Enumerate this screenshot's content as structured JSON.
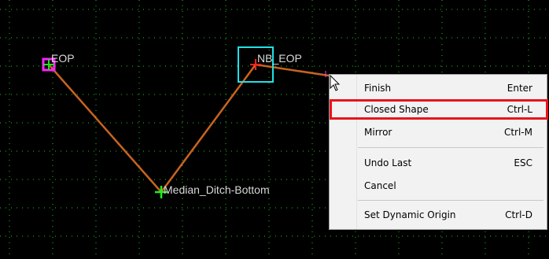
{
  "canvas": {
    "background": "#000000",
    "grid_color": "#1ec81e",
    "line_color": "#c8641e"
  },
  "points": {
    "eop": "EOP",
    "nb_eop": "NB_EOP",
    "median": "Median_Ditch-Bottom"
  },
  "context_menu": {
    "items": [
      {
        "label": "Finish",
        "shortcut": "Enter"
      },
      {
        "label": "Closed Shape",
        "shortcut": "Ctrl-L"
      },
      {
        "label": "Mirror",
        "shortcut": "Ctrl-M"
      },
      {
        "label": "Undo Last",
        "shortcut": "ESC"
      },
      {
        "label": "Cancel",
        "shortcut": ""
      },
      {
        "label": "Set Dynamic Origin",
        "shortcut": "Ctrl-D"
      }
    ],
    "highlight_color": "#e8141c"
  },
  "icons": {
    "cursor": "mouse-pointer-icon"
  }
}
